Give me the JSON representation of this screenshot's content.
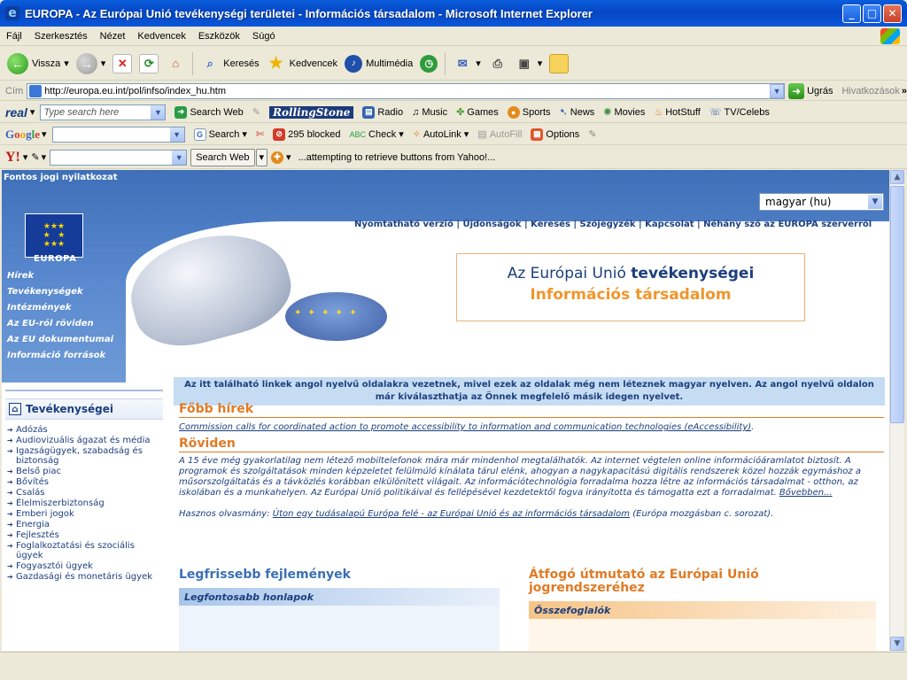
{
  "window": {
    "title": "EUROPA - Az Európai Unió tevékenységi területei - Információs társadalom - Microsoft Internet Explorer"
  },
  "menubar": {
    "items": [
      "Fájl",
      "Szerkesztés",
      "Nézet",
      "Kedvencek",
      "Eszközök",
      "Súgó"
    ]
  },
  "toolbar": {
    "back": "Vissza",
    "search": "Keresés",
    "favorites": "Kedvencek",
    "media": "Multimédia"
  },
  "address": {
    "label": "Cím",
    "url": "http://europa.eu.int/pol/infso/index_hu.htm",
    "go": "Ugrás",
    "links": "Hivatkozások"
  },
  "realbar": {
    "placeholder": "Type search here",
    "search_web": "Search Web",
    "radio": "Radio",
    "music": "Music",
    "games": "Games",
    "sports": "Sports",
    "news": "News",
    "movies": "Movies",
    "hotstuff": "HotStuff",
    "tvcelebs": "TV/Celebs"
  },
  "googlebar": {
    "search": "Search",
    "blocked": "295 blocked",
    "check": "Check",
    "autolink": "AutoLink",
    "autofill": "AutoFill",
    "options": "Options"
  },
  "yahoobar": {
    "search_web": "Search Web",
    "status": "...attempting to retrieve buttons from Yahoo!..."
  },
  "page": {
    "legal": "Fontos jogi nyilatkozat",
    "language": "magyar (hu)",
    "europa": "EUROPA",
    "toplinks": "Nyomtatható verzió | Újdonságok | Keresés | Szójegyzék | Kapcsolat | Néhány szó az EUROPA szerverről",
    "nav": [
      "Hírek",
      "Tevékenységek",
      "Intézmények",
      "Az EU-ról röviden",
      "Az EU dokumentumai",
      "Információ források"
    ],
    "title_line1": "Az Európai Unió ",
    "title_bold": "tevékenységei",
    "title_line2": "Információs társadalom",
    "notice": "Az itt található linkek angol nyelvű oldalakra vezetnek, mivel ezek az oldalak még nem léteznek magyar nyelven. Az angol nyelvű oldalon már kiválaszthatja az Önnek megfelelő másik idegen nyelvet.",
    "left_title": "Tevékenységei",
    "left_items": [
      "Adózás",
      "Audiovizuális ágazat és média",
      "Igazságügyek, szabadság és biztonság",
      "Belső piac",
      "Bővítés",
      "Csalás",
      "Élelmiszerbiztonság",
      "Emberi jogok",
      "Energia",
      "Fejlesztés",
      "Foglalkoztatási és szociális ügyek",
      "Fogyasztói ügyek",
      "Gazdasági és monetáris ügyek"
    ],
    "fobb_hirek": "Főbb hírek",
    "news_link": "Commission calls for coordinated action to promote accessibility to information and communication technologies (eAccessibility)",
    "roviden": "Röviden",
    "body_text": "A 15 éve még gyakorlatilag nem létező mobiltelefonok mára már mindenhol megtalálhatók. Az internet végtelen online információáramlatot biztosít. A programok és szolgáltatások minden képzeletet felülmúló kínálata tárul elénk, ahogyan a nagykapacitású digitális rendszerek közel hozzák egymáshoz a műsorszolgáltatás és a távközlés korábban elkülönített világait. Az információtechnológia forradalma hozza létre az információs társadalmat - otthon, az iskolában és a munkahelyen. Az Európai Unió politikáival és fellépésével kezdetektől fogva irányította és támogatta ezt a forradalmat.",
    "more": "Bővebben...",
    "useful_prefix": "Hasznos olvasmány: ",
    "useful_link": "Úton egy tudásalapú Európa felé - az Európai Unió és az információs társadalom",
    "useful_suffix": " (Európa mozgásban c. sorozat).",
    "col1_title": "Legfrissebb fejlemények",
    "col1_sub": "Legfontosabb honlapok",
    "col2_title": "Átfogó útmutató az Európai Unió jogrendszeréhez",
    "col2_sub": "Összefoglalók"
  }
}
